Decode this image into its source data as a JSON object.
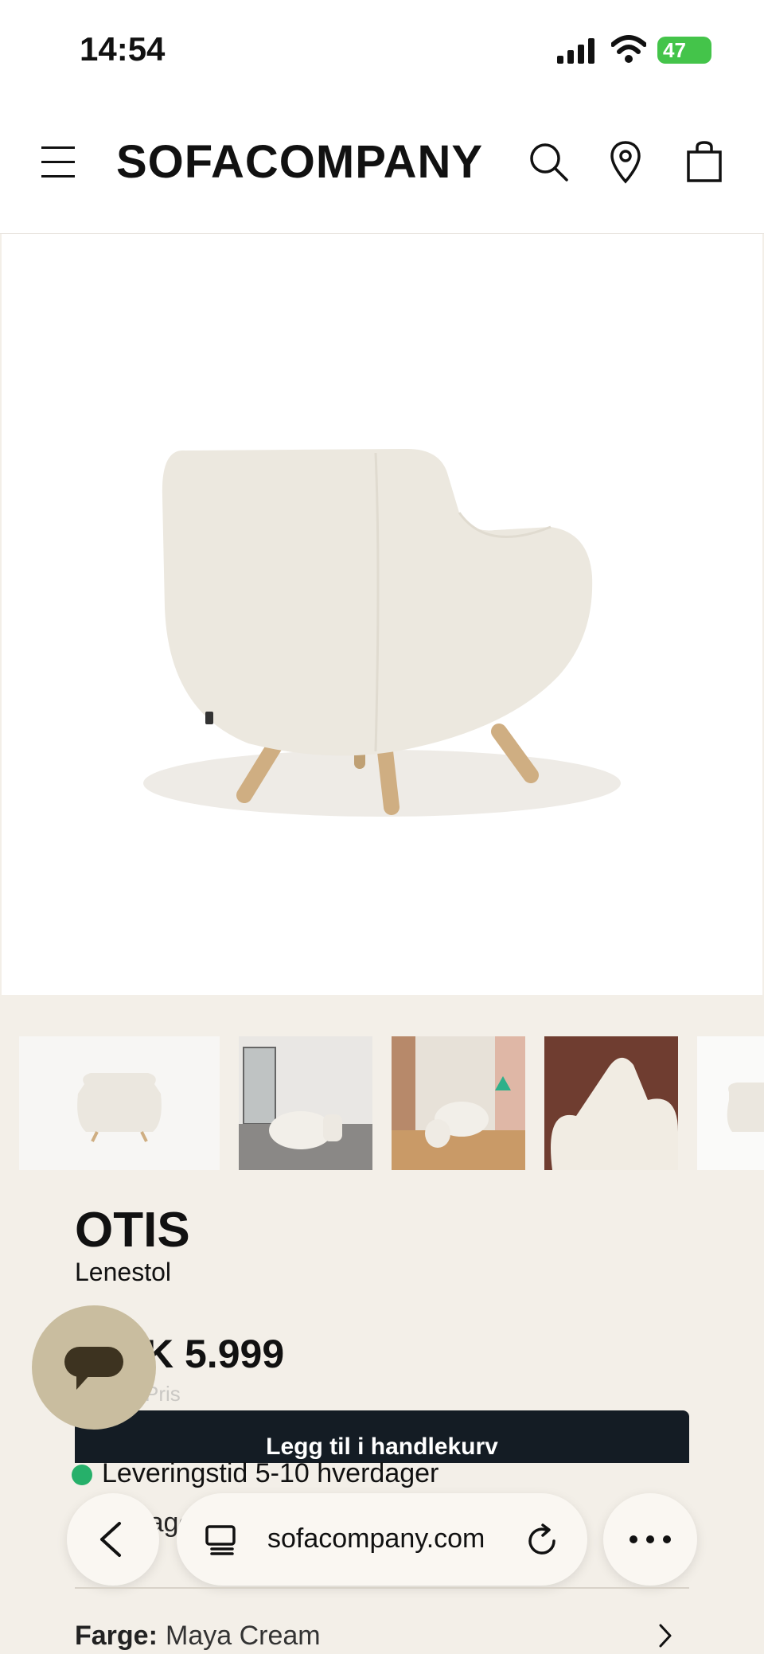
{
  "status": {
    "time": "14:54",
    "battery": "47"
  },
  "header": {
    "brand": "SOFACOMPANY"
  },
  "product": {
    "name": "OTIS",
    "subtitle": "Lenestol",
    "price": "K 5.999",
    "price_note": "Pris",
    "cta_label": "Legg til i handlekurv",
    "delivery": "Leveringstid 5-10 hverdager",
    "stock": "På lager",
    "color_label": "Farge:",
    "color_value": "Maya Cream"
  },
  "browser": {
    "url": "sofacompany.com"
  },
  "colors": {
    "accent": "#141c24",
    "background": "#f3efe8",
    "chat": "#c9bd9f",
    "status_ok": "#26b06a"
  },
  "icons": [
    "menu-icon",
    "search-icon",
    "location-pin-icon",
    "shopping-bag-icon",
    "chat-icon",
    "back-icon",
    "tabs-icon",
    "reload-icon",
    "more-icon",
    "chevron-right-icon"
  ]
}
